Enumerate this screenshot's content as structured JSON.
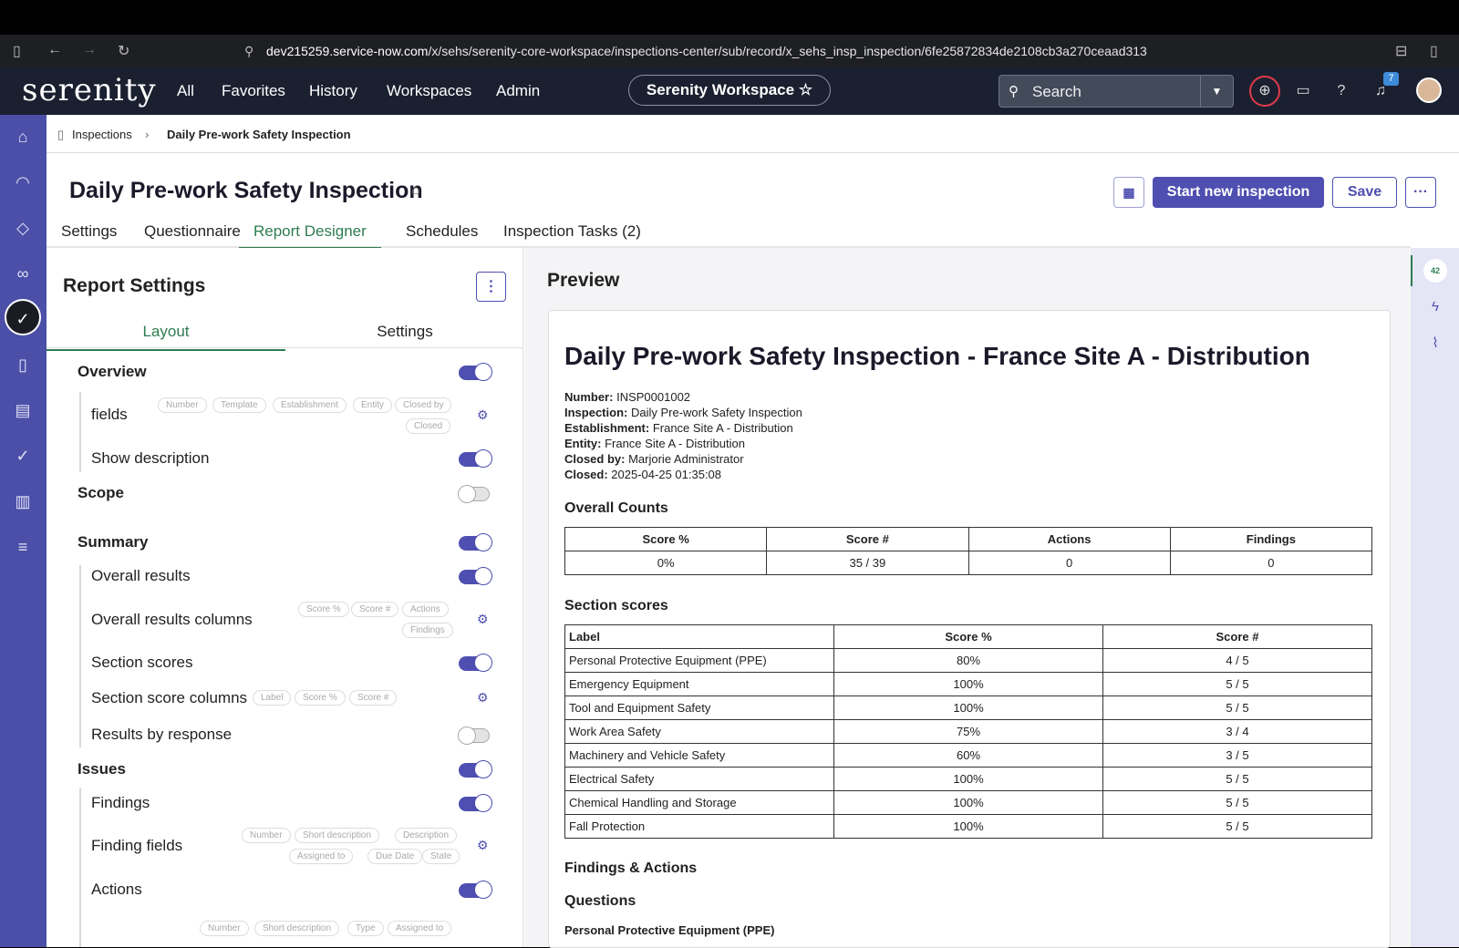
{
  "browser": {
    "url_host": "dev215259.service-now.com",
    "url_path": "/x/sehs/serenity-core-workspace/inspections-center/sub/record/x_sehs_insp_inspection/6fe25872834de2108cb3a270ceaad313"
  },
  "appbar": {
    "logo": "serenity",
    "nav": [
      "All",
      "Favorites",
      "History",
      "Workspaces",
      "Admin"
    ],
    "workspace_label": "Serenity Workspace",
    "search_placeholder": "Search",
    "notifications_count": "7"
  },
  "breadcrumb": {
    "parent": "Inspections",
    "current": "Daily Pre-work Safety Inspection"
  },
  "record": {
    "title": "Daily Pre-work Safety Inspection",
    "primary_button": "Start new inspection",
    "save_button": "Save"
  },
  "tabs": [
    "Settings",
    "Questionnaire",
    "Report Designer",
    "Schedules",
    "Inspection Tasks (2)"
  ],
  "report_settings": {
    "title": "Report Settings",
    "subtabs": [
      "Layout",
      "Settings"
    ],
    "rows": {
      "overview": "Overview",
      "fields": "fields",
      "show_description": "Show description",
      "scope": "Scope",
      "summary": "Summary",
      "overall_results": "Overall results",
      "overall_results_columns": "Overall results columns",
      "section_scores": "Section scores",
      "section_score_columns": "Section score columns",
      "results_by_response": "Results by response",
      "issues": "Issues",
      "findings": "Findings",
      "finding_fields": "Finding fields",
      "actions": "Actions"
    },
    "chips": {
      "fields": [
        "Number",
        "Template",
        "Establishment",
        "Entity",
        "Closed by",
        "Closed"
      ],
      "overall_results_columns": [
        "Score %",
        "Score #",
        "Actions",
        "Findings"
      ],
      "section_score_columns": [
        "Label",
        "Score %",
        "Score #"
      ],
      "finding_fields": [
        "Number",
        "Short description",
        "Description",
        "Assigned to",
        "Due Date",
        "State"
      ],
      "action_fields": [
        "Number",
        "Short description",
        "Type",
        "Assigned to"
      ]
    }
  },
  "preview": {
    "title": "Preview",
    "doc_title": "Daily Pre-work Safety Inspection - France Site A - Distribution",
    "meta": [
      {
        "k": "Number:",
        "v": "INSP0001002"
      },
      {
        "k": "Inspection:",
        "v": "Daily Pre-work Safety Inspection"
      },
      {
        "k": "Establishment:",
        "v": "France Site A - Distribution"
      },
      {
        "k": "Entity:",
        "v": "France Site A - Distribution"
      },
      {
        "k": "Closed by:",
        "v": "Marjorie Administrator"
      },
      {
        "k": "Closed:",
        "v": "2025-04-25 01:35:08"
      }
    ],
    "overall_counts_title": "Overall Counts",
    "overall_headers": [
      "Score %",
      "Score #",
      "Actions",
      "Findings"
    ],
    "overall_values": [
      "0%",
      "35 / 39",
      "0",
      "0"
    ],
    "section_scores_title": "Section scores",
    "section_headers": [
      "Label",
      "Score %",
      "Score #"
    ],
    "section_rows": [
      [
        "Personal Protective Equipment (PPE)",
        "80%",
        "4 / 5"
      ],
      [
        "Emergency Equipment",
        "100%",
        "5 / 5"
      ],
      [
        "Tool and Equipment Safety",
        "100%",
        "5 / 5"
      ],
      [
        "Work Area Safety",
        "75%",
        "3 / 4"
      ],
      [
        "Machinery and Vehicle Safety",
        "60%",
        "3 / 5"
      ],
      [
        "Electrical Safety",
        "100%",
        "5 / 5"
      ],
      [
        "Chemical Handling and Storage",
        "100%",
        "5 / 5"
      ],
      [
        "Fall Protection",
        "100%",
        "5 / 5"
      ]
    ],
    "findings_title": "Findings & Actions",
    "questions_title": "Questions",
    "questions_section": "Personal Protective Equipment (PPE)"
  },
  "rail": {
    "badge": "42"
  },
  "colors": {
    "accent": "#4e4fb0",
    "active_tab": "#2e7d50",
    "leftnav": "#4b4fa8"
  }
}
